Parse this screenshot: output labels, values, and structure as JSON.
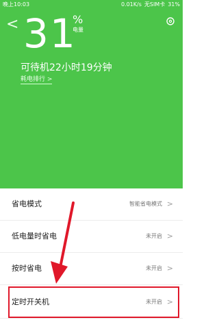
{
  "status_bar": {
    "time": "晚上10:03",
    "speed": "0.01K/s",
    "sim": "无SIM卡",
    "battery": "31%"
  },
  "hero": {
    "battery_level": "31",
    "percent_sign": "%",
    "unit_label": "电量",
    "standby_text": "可待机22小时19分钟",
    "rank_link": "耗电排行",
    "rank_link_chevron": ">",
    "back_icon": "<",
    "colors": {
      "green": "#4cc54a"
    }
  },
  "settings": [
    {
      "label": "省电模式",
      "value": "智能省电模式",
      "chevron": ">"
    },
    {
      "label": "低电量时省电",
      "value": "未开启",
      "chevron": ">"
    },
    {
      "label": "按时省电",
      "value": "未开启",
      "chevron": ">"
    },
    {
      "label": "定时开关机",
      "value": "未开启",
      "chevron": ">"
    }
  ],
  "annotation": {
    "highlight_color": "#e0182a"
  }
}
